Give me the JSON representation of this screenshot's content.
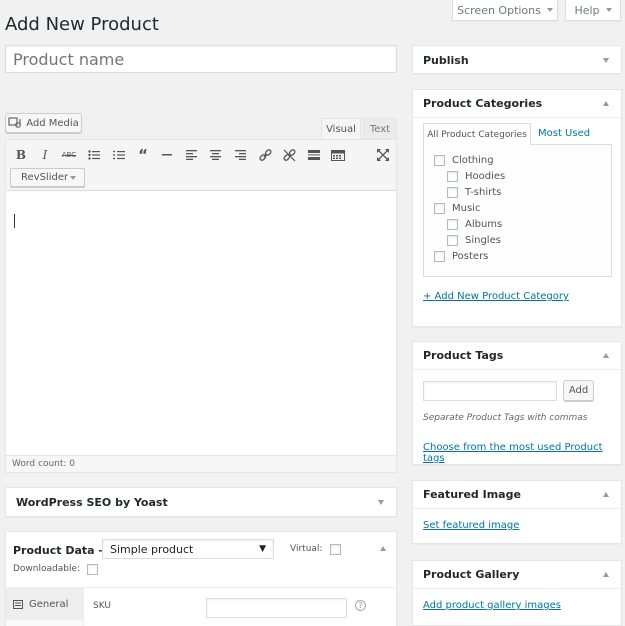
{
  "page": {
    "title": "Add New Product"
  },
  "screen_options": {
    "label": "Screen Options"
  },
  "help": {
    "label": "Help"
  },
  "product_name": {
    "placeholder": "Product name"
  },
  "editor": {
    "add_media": "Add Media",
    "tab_visual": "Visual",
    "tab_text": "Text",
    "revslider": "RevSlider",
    "word_count": "Word count: 0",
    "tools": [
      "bold-icon",
      "italic-icon",
      "strikethrough-icon",
      "bullet-list-icon",
      "numbered-list-icon",
      "blockquote-icon",
      "horizontal-rule-icon",
      "align-left-icon",
      "align-center-icon",
      "align-right-icon",
      "insert-link-icon",
      "remove-link-icon",
      "read-more-icon",
      "toolbar-toggle-icon",
      "fullscreen-icon"
    ]
  },
  "seo": {
    "title": "WordPress SEO by Yoast"
  },
  "product_data": {
    "title": "Product Data —",
    "type_selected": "Simple product",
    "virtual_label": "Virtual:",
    "downloadable_label": "Downloadable:",
    "tab_general": "General",
    "sku_label": "SKU"
  },
  "publish": {
    "title": "Publish"
  },
  "categories": {
    "title": "Product Categories",
    "tab_all": "All Product Categories",
    "tab_most_used": "Most Used",
    "items": [
      {
        "label": "Clothing",
        "level": 0
      },
      {
        "label": "Hoodies",
        "level": 1
      },
      {
        "label": "T-shirts",
        "level": 1
      },
      {
        "label": "Music",
        "level": 0
      },
      {
        "label": "Albums",
        "level": 1
      },
      {
        "label": "Singles",
        "level": 1
      },
      {
        "label": "Posters",
        "level": 0
      }
    ],
    "add_new": "+ Add New Product Category"
  },
  "tags": {
    "title": "Product Tags",
    "add_button": "Add",
    "hint": "Separate Product Tags with commas",
    "choose_link": "Choose from the most used Product tags"
  },
  "featured_image": {
    "title": "Featured Image",
    "link": "Set featured image"
  },
  "gallery": {
    "title": "Product Gallery",
    "link": "Add product gallery images"
  },
  "colors": {
    "link": "#0073aa",
    "background": "#f1f1f1",
    "panel": "#ffffff"
  }
}
